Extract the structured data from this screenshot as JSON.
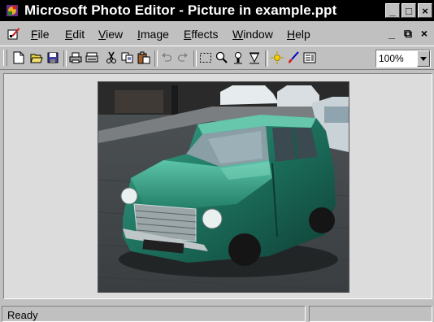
{
  "window": {
    "title": "Microsoft Photo Editor - Picture in example.ppt",
    "controls": {
      "minimize": "_",
      "maximize": "□",
      "close": "×"
    }
  },
  "menu": {
    "items": [
      "File",
      "Edit",
      "View",
      "Image",
      "Effects",
      "Window",
      "Help"
    ],
    "doc_controls": {
      "minimize": "_",
      "restore": "⧉",
      "close": "×"
    }
  },
  "toolbar": {
    "buttons": [
      "new-icon",
      "open-icon",
      "save-icon",
      "print-icon",
      "scan-icon",
      "cut-icon",
      "copy-icon",
      "paste-icon",
      "undo-icon",
      "redo-icon",
      "select-icon",
      "zoom-icon",
      "smudge-icon",
      "sharpen-icon",
      "balance-icon",
      "paintbrush-icon",
      "properties-icon"
    ],
    "zoom": "100%"
  },
  "picture": {
    "subject": "green-mini-car-photo"
  },
  "statusbar": {
    "text": "Ready",
    "right_pane": ""
  },
  "colors": {
    "title_bg": "#000000",
    "face": "#c0c0c0",
    "client": "#dcdcdc"
  }
}
